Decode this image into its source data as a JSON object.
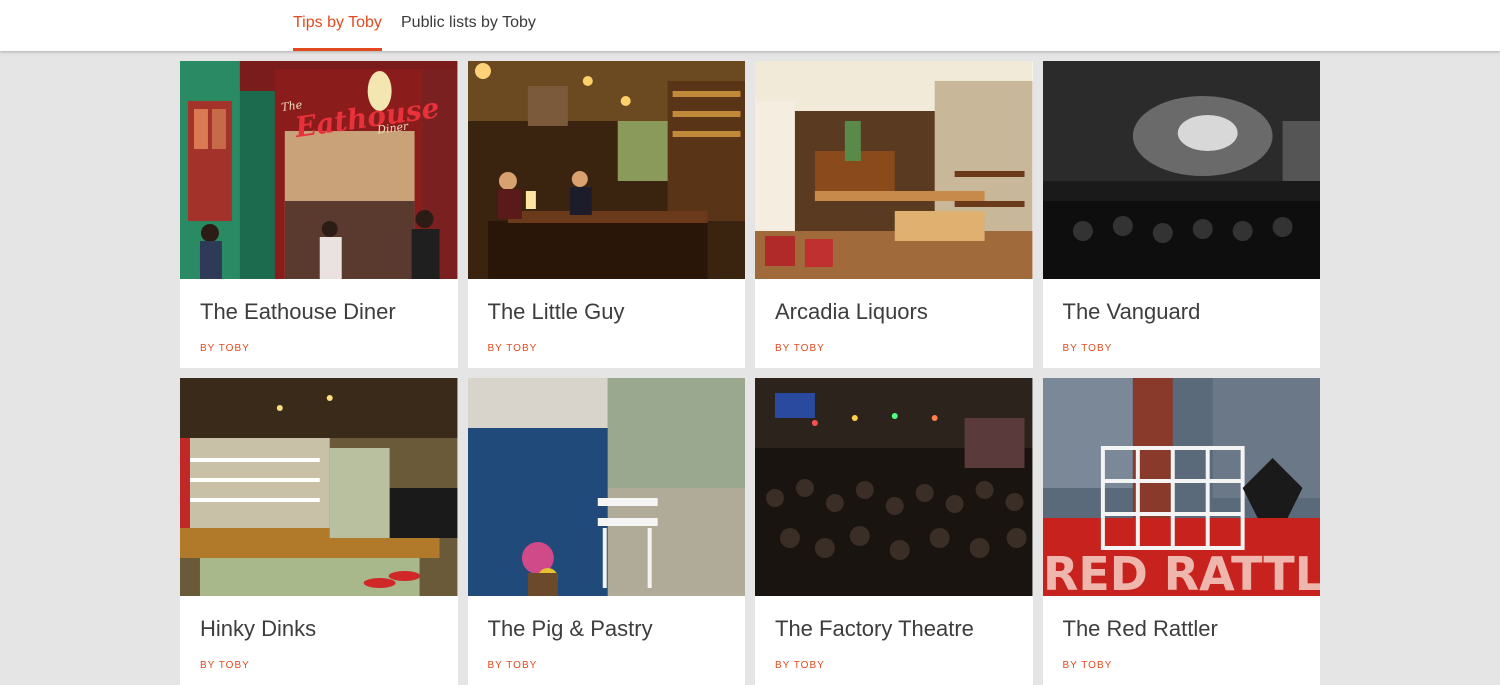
{
  "tabs": [
    {
      "label": "Tips by Toby",
      "active": true
    },
    {
      "label": "Public lists by Toby",
      "active": false
    }
  ],
  "accent_color": "#e04a1e",
  "cards": [
    {
      "title": "The Eathouse Diner",
      "author": "BY TOBY",
      "sign_text": "Eathouse",
      "sign_sub": "The",
      "sign_diner": "Diner"
    },
    {
      "title": "The Little Guy",
      "author": "BY TOBY"
    },
    {
      "title": "Arcadia Liquors",
      "author": "BY TOBY"
    },
    {
      "title": "The Vanguard",
      "author": "BY TOBY"
    },
    {
      "title": "Hinky Dinks",
      "author": "BY TOBY"
    },
    {
      "title": "The Pig & Pastry",
      "author": "BY TOBY"
    },
    {
      "title": "The Factory Theatre",
      "author": "BY TOBY"
    },
    {
      "title": "The Red Rattler",
      "author": "BY TOBY",
      "sign_text": "RED RATTLE"
    }
  ]
}
